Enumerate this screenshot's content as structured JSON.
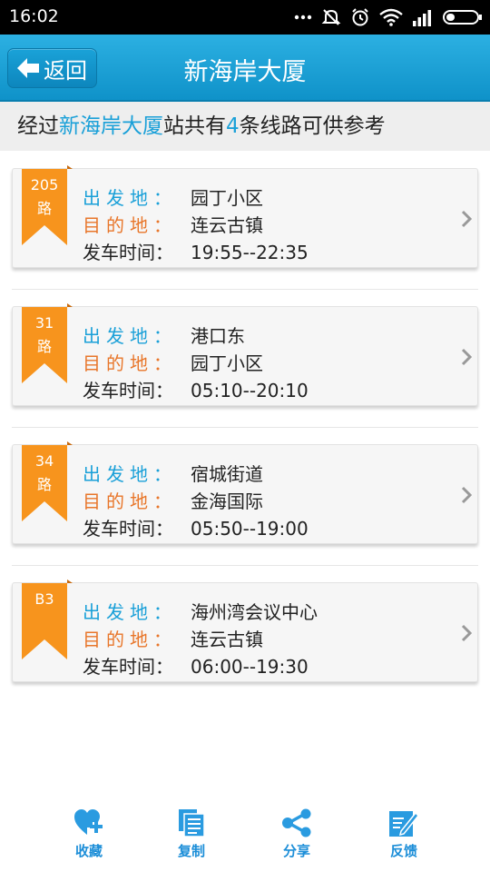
{
  "status_bar": {
    "time": "16:02"
  },
  "header": {
    "back_label": "返回",
    "title": "新海岸大厦"
  },
  "summary": {
    "prefix": "经过",
    "station": "新海岸大厦",
    "middle": "站共有",
    "count": "4",
    "suffix": "条线路可供参考"
  },
  "labels": {
    "start": "出发地：",
    "dest": "目的地：",
    "time": "发车时间：",
    "route_unit": "路"
  },
  "routes": [
    {
      "number": "205",
      "start": "园丁小区",
      "dest": "连云古镇",
      "time": "19:55--22:35"
    },
    {
      "number": "31",
      "start": "港口东",
      "dest": "园丁小区",
      "time": "05:10--20:10"
    },
    {
      "number": "34",
      "start": "宿城街道",
      "dest": "金海国际",
      "time": "05:50--19:00"
    },
    {
      "number": "B3",
      "start": "海州湾会议中心",
      "dest": "连云古镇",
      "time": "06:00--19:30"
    }
  ],
  "bottom_bar": {
    "favorite": "收藏",
    "copy": "复制",
    "share": "分享",
    "feedback": "反馈"
  },
  "colors": {
    "header": "#1aa0d8",
    "accent_blue": "#1aa0d8",
    "accent_orange": "#e8762a",
    "ribbon": "#f7941d",
    "tab": "#1c8ed8"
  },
  "icons": [
    "back-arrow-icon",
    "chevron-right-icon",
    "heart-plus-icon",
    "document-icon",
    "share-icon",
    "edit-icon"
  ]
}
